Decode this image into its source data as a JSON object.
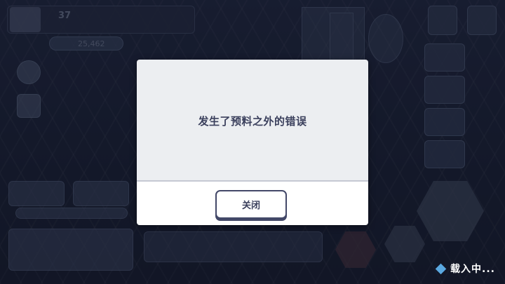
{
  "dialog": {
    "message": "发生了预料之外的错误",
    "close_label": "关闭"
  },
  "loading": {
    "text": "载入中..."
  },
  "hud": {
    "level": "37",
    "gems": "25,462"
  },
  "colors": {
    "dialog_body": "#eceef1",
    "dialog_footer": "#ffffff",
    "button_border": "#434868",
    "text_dark": "#3a3f5c",
    "loading_diamond": "#5aa8e0"
  }
}
